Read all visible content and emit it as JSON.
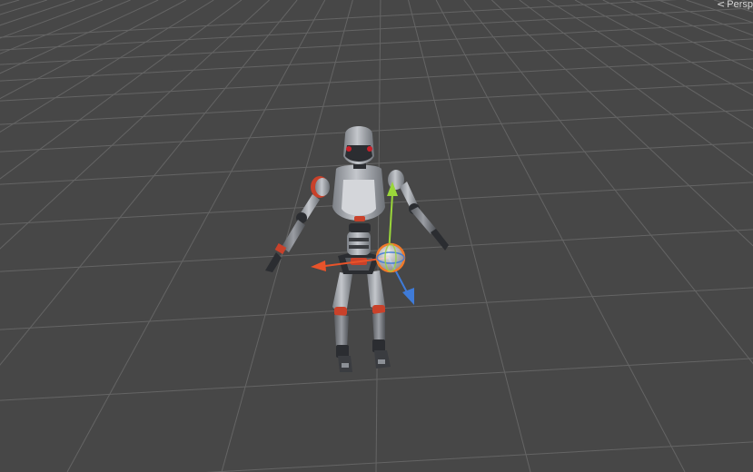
{
  "scene_view": {
    "projection_label": "Persp",
    "background_color": "#474747",
    "grid_color": "#6a6a6a",
    "gizmo": {
      "x_axis_color": "#e8532a",
      "y_axis_color": "#9ad63a",
      "z_axis_color": "#3f7bd8",
      "rotation_ring_color": "#f07a2a"
    },
    "model": {
      "body_color": "#a9adb4",
      "joint_color": "#2b2d31",
      "accent_color": "#d4542a",
      "eye_color": "#c8202a"
    }
  }
}
